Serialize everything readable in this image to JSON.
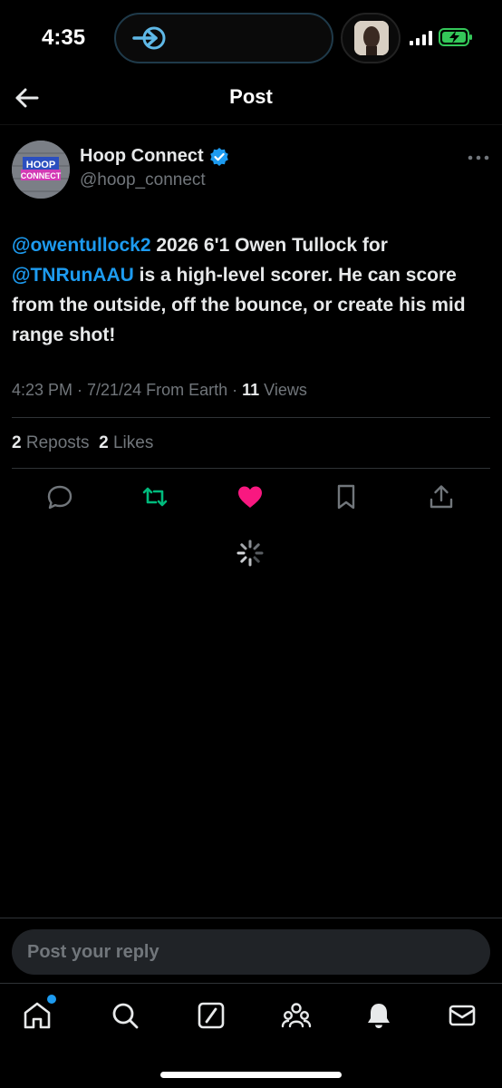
{
  "status": {
    "time": "4:35"
  },
  "header": {
    "title": "Post"
  },
  "post": {
    "author_name": "Hoop Connect",
    "author_handle": "@hoop_connect",
    "avatar_text_line1": "HOOP",
    "avatar_text_line2": "CONNECT",
    "text_segments": [
      {
        "type": "mention",
        "text": "@owentullock2"
      },
      {
        "type": "text",
        "text": " 2026 6'1 Owen Tullock for "
      },
      {
        "type": "mention",
        "text": "@TNRunAAU"
      },
      {
        "type": "text",
        "text": " is a high-level scorer. He can score from the outside, off the bounce,  or create his mid range shot!"
      }
    ],
    "meta": {
      "timestamp": "4:23 PM · 7/21/24 From Earth · ",
      "views_count": "11",
      "views_label": " Views"
    },
    "stats": {
      "reposts_count": "2",
      "reposts_label": " Reposts",
      "likes_count": "2",
      "likes_label": " Likes"
    }
  },
  "reply": {
    "placeholder": "Post your reply"
  },
  "colors": {
    "accent": "#1d9bf0",
    "repost": "#00ba7c",
    "like": "#f91880",
    "secondary": "#71767b"
  },
  "icons": {
    "actions": [
      "reply-icon",
      "repost-icon",
      "like-icon",
      "bookmark-icon",
      "share-icon"
    ],
    "nav": [
      "home-icon",
      "search-icon",
      "grok-icon",
      "communities-icon",
      "notifications-icon",
      "messages-icon"
    ]
  }
}
